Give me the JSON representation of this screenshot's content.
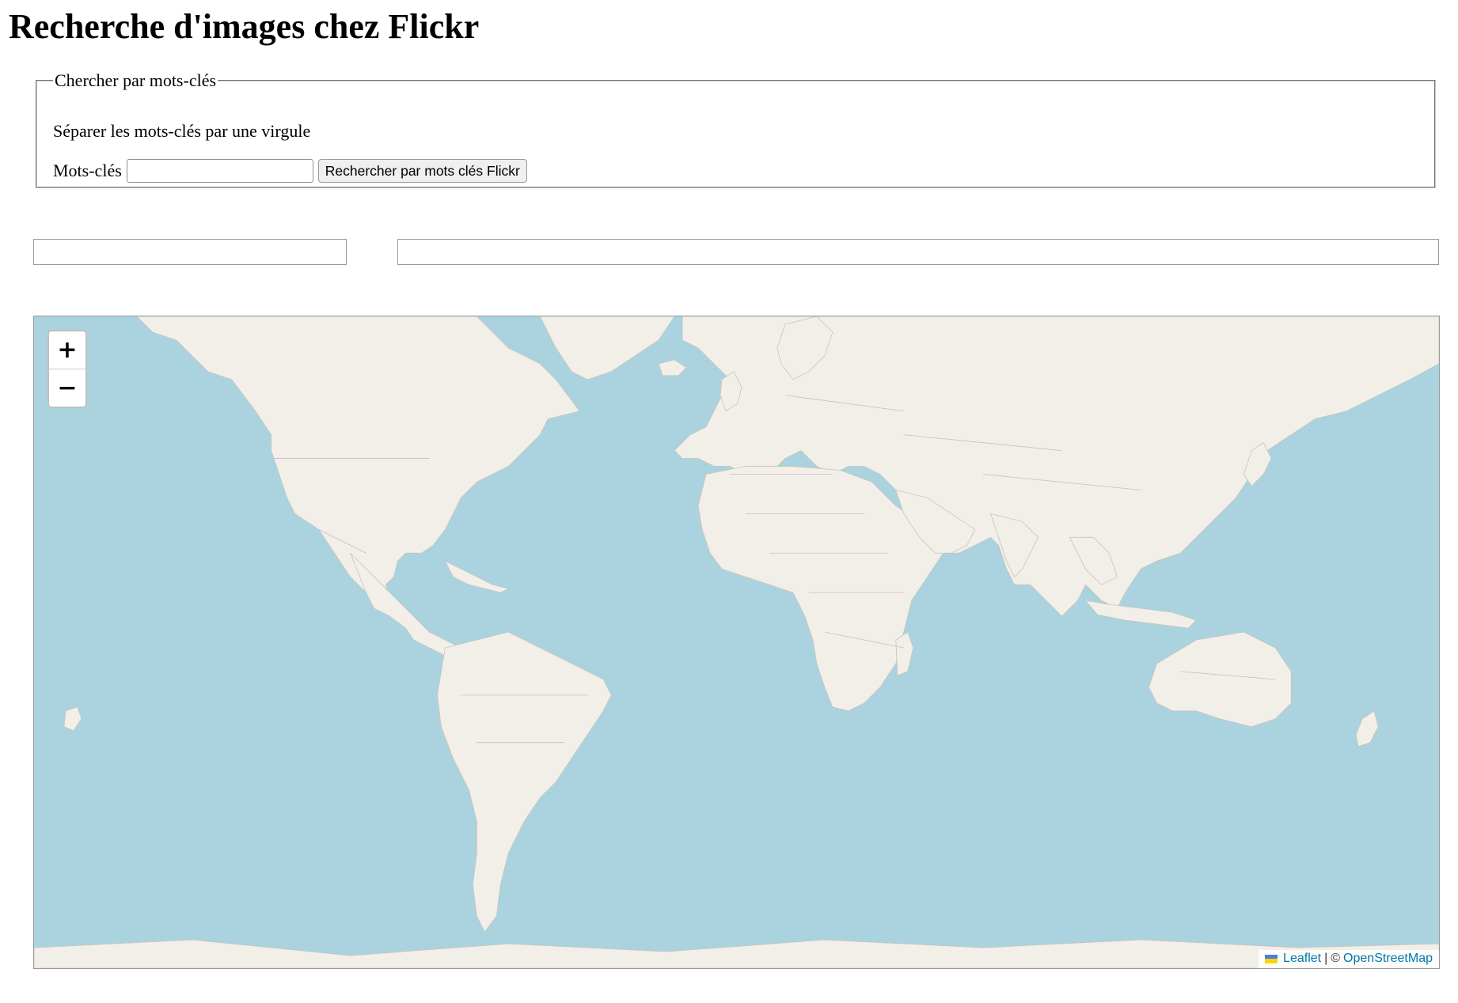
{
  "page": {
    "title": "Recherche d'images chez Flickr"
  },
  "search": {
    "legend": "Chercher par mots-clés",
    "hint": "Séparer les mots-clés par une virgule",
    "keywords_label": "Mots-clés",
    "keywords_value": "",
    "button_label": "Rechercher par mots clés Flickr"
  },
  "results": {
    "left_value": "",
    "right_value": ""
  },
  "map": {
    "zoom_in_label": "+",
    "zoom_out_label": "−",
    "attribution": {
      "leaflet_label": "Leaflet",
      "separator": "|",
      "copyright": "©",
      "osm_label": "OpenStreetMap"
    },
    "colors": {
      "water": "#aad3df",
      "land": "#f2efe9",
      "borders": "#d3b3cf",
      "link": "#0078a8"
    },
    "icons": [
      "ukraine-flag-icon"
    ]
  }
}
